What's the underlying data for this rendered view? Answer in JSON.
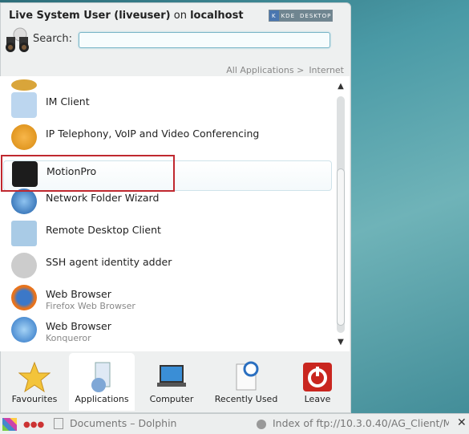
{
  "header": {
    "user": "Live System User (liveuser)",
    "on": "on",
    "host": "localhost",
    "logo": "KDE DESKTOP"
  },
  "search": {
    "label": "Search:",
    "value": "",
    "placeholder": ""
  },
  "breadcrumb": [
    "All Applications >",
    "Internet"
  ],
  "items": [
    {
      "title": "IM Client",
      "subtitle": "",
      "icon": "im-client-icon"
    },
    {
      "title": "IP Telephony, VoIP and Video Conferencing",
      "subtitle": "",
      "icon": "voip-icon"
    },
    {
      "title": "MotionPro",
      "subtitle": "",
      "icon": "motionpro-icon",
      "selected": true
    },
    {
      "title": "Network Folder Wizard",
      "subtitle": "",
      "icon": "network-globe-icon"
    },
    {
      "title": "Remote Desktop Client",
      "subtitle": "",
      "icon": "remote-desktop-icon"
    },
    {
      "title": "SSH agent identity adder",
      "subtitle": "",
      "icon": "key-icon"
    },
    {
      "title": "Web Browser",
      "subtitle": "Firefox Web Browser",
      "icon": "firefox-icon"
    },
    {
      "title": "Web Browser",
      "subtitle": "Konqueror",
      "icon": "konqueror-icon"
    }
  ],
  "tabs": [
    {
      "label": "Favourites",
      "icon": "star-icon"
    },
    {
      "label": "Applications",
      "icon": "applications-icon",
      "active": true
    },
    {
      "label": "Computer",
      "icon": "laptop-icon"
    },
    {
      "label": "Recently Used",
      "icon": "clock-document-icon"
    },
    {
      "label": "Leave",
      "icon": "power-icon"
    }
  ],
  "taskbar": {
    "task1": "Documents – Dolphin",
    "task2": "Index of ftp://10.3.0.40/AG_Client/M"
  },
  "colors": {
    "highlight_box": "#c0282f",
    "search_border": "#7ab6c8"
  }
}
